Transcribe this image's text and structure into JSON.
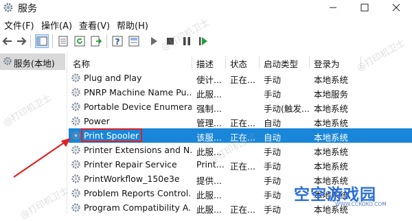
{
  "window": {
    "title": "服务"
  },
  "menu": [
    "文件(F)",
    "操作(A)",
    "查看(V)",
    "帮助(H)"
  ],
  "tree": {
    "label": "服务(本地)"
  },
  "columns": [
    "名称",
    "描述",
    "状态",
    "启动类型",
    "登录为"
  ],
  "rows": [
    {
      "name": "Plug and Play",
      "desc": "使计...",
      "status": "正在...",
      "start": "手动",
      "logon": "本地系统"
    },
    {
      "name": "PNRP Machine Name Pu...",
      "desc": "此服...",
      "status": "",
      "start": "手动",
      "logon": "本地服务"
    },
    {
      "name": "Portable Device Enumera...",
      "desc": "强制...",
      "status": "",
      "start": "手动(触发...",
      "logon": "本地系统"
    },
    {
      "name": "Power",
      "desc": "管理...",
      "status": "正在...",
      "start": "自动",
      "logon": "本地系统"
    },
    {
      "name": "Print Spooler",
      "desc": "该服...",
      "status": "正在...",
      "start": "自动",
      "logon": "本地系统"
    },
    {
      "name": "Printer Extensions and N...",
      "desc": "此服...",
      "status": "",
      "start": "手动",
      "logon": "本地系统"
    },
    {
      "name": "Printer Repair Service",
      "desc": "Print...",
      "status": "正在...",
      "start": "手动",
      "logon": "本地系统"
    },
    {
      "name": "PrintWorkflow_150e3e",
      "desc": "提供...",
      "status": "",
      "start": "手动",
      "logon": "本地系统"
    },
    {
      "name": "Problem Reports Control...",
      "desc": "此服...",
      "status": "",
      "start": "手动",
      "logon": "本地系统"
    },
    {
      "name": "Program Compatibility A...",
      "desc": "此服...",
      "status": "正在...",
      "start": "手动",
      "logon": "本地系统"
    }
  ],
  "selected_row": 4,
  "watermark": "@打印机卫士",
  "brand": {
    "name": "空空游戏园",
    "url": "WWW.CCKOKO.COM"
  },
  "colors": {
    "selection": "#1a86d9",
    "annotation": "#e02020",
    "brand": "#2a6fdb"
  }
}
